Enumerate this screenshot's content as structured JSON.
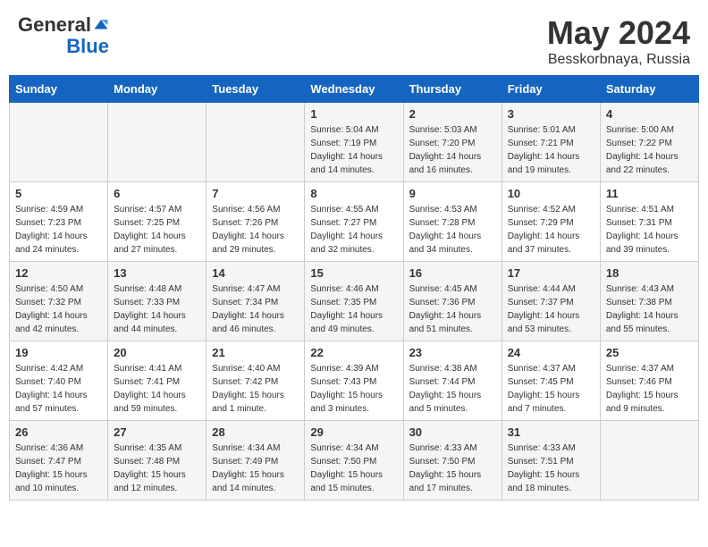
{
  "header": {
    "logo_general": "General",
    "logo_blue": "Blue",
    "title": "May 2024",
    "location": "Besskorbnaya, Russia"
  },
  "weekdays": [
    "Sunday",
    "Monday",
    "Tuesday",
    "Wednesday",
    "Thursday",
    "Friday",
    "Saturday"
  ],
  "weeks": [
    [
      {
        "day": "",
        "info": ""
      },
      {
        "day": "",
        "info": ""
      },
      {
        "day": "",
        "info": ""
      },
      {
        "day": "1",
        "info": "Sunrise: 5:04 AM\nSunset: 7:19 PM\nDaylight: 14 hours\nand 14 minutes."
      },
      {
        "day": "2",
        "info": "Sunrise: 5:03 AM\nSunset: 7:20 PM\nDaylight: 14 hours\nand 16 minutes."
      },
      {
        "day": "3",
        "info": "Sunrise: 5:01 AM\nSunset: 7:21 PM\nDaylight: 14 hours\nand 19 minutes."
      },
      {
        "day": "4",
        "info": "Sunrise: 5:00 AM\nSunset: 7:22 PM\nDaylight: 14 hours\nand 22 minutes."
      }
    ],
    [
      {
        "day": "5",
        "info": "Sunrise: 4:59 AM\nSunset: 7:23 PM\nDaylight: 14 hours\nand 24 minutes."
      },
      {
        "day": "6",
        "info": "Sunrise: 4:57 AM\nSunset: 7:25 PM\nDaylight: 14 hours\nand 27 minutes."
      },
      {
        "day": "7",
        "info": "Sunrise: 4:56 AM\nSunset: 7:26 PM\nDaylight: 14 hours\nand 29 minutes."
      },
      {
        "day": "8",
        "info": "Sunrise: 4:55 AM\nSunset: 7:27 PM\nDaylight: 14 hours\nand 32 minutes."
      },
      {
        "day": "9",
        "info": "Sunrise: 4:53 AM\nSunset: 7:28 PM\nDaylight: 14 hours\nand 34 minutes."
      },
      {
        "day": "10",
        "info": "Sunrise: 4:52 AM\nSunset: 7:29 PM\nDaylight: 14 hours\nand 37 minutes."
      },
      {
        "day": "11",
        "info": "Sunrise: 4:51 AM\nSunset: 7:31 PM\nDaylight: 14 hours\nand 39 minutes."
      }
    ],
    [
      {
        "day": "12",
        "info": "Sunrise: 4:50 AM\nSunset: 7:32 PM\nDaylight: 14 hours\nand 42 minutes."
      },
      {
        "day": "13",
        "info": "Sunrise: 4:48 AM\nSunset: 7:33 PM\nDaylight: 14 hours\nand 44 minutes."
      },
      {
        "day": "14",
        "info": "Sunrise: 4:47 AM\nSunset: 7:34 PM\nDaylight: 14 hours\nand 46 minutes."
      },
      {
        "day": "15",
        "info": "Sunrise: 4:46 AM\nSunset: 7:35 PM\nDaylight: 14 hours\nand 49 minutes."
      },
      {
        "day": "16",
        "info": "Sunrise: 4:45 AM\nSunset: 7:36 PM\nDaylight: 14 hours\nand 51 minutes."
      },
      {
        "day": "17",
        "info": "Sunrise: 4:44 AM\nSunset: 7:37 PM\nDaylight: 14 hours\nand 53 minutes."
      },
      {
        "day": "18",
        "info": "Sunrise: 4:43 AM\nSunset: 7:38 PM\nDaylight: 14 hours\nand 55 minutes."
      }
    ],
    [
      {
        "day": "19",
        "info": "Sunrise: 4:42 AM\nSunset: 7:40 PM\nDaylight: 14 hours\nand 57 minutes."
      },
      {
        "day": "20",
        "info": "Sunrise: 4:41 AM\nSunset: 7:41 PM\nDaylight: 14 hours\nand 59 minutes."
      },
      {
        "day": "21",
        "info": "Sunrise: 4:40 AM\nSunset: 7:42 PM\nDaylight: 15 hours\nand 1 minute."
      },
      {
        "day": "22",
        "info": "Sunrise: 4:39 AM\nSunset: 7:43 PM\nDaylight: 15 hours\nand 3 minutes."
      },
      {
        "day": "23",
        "info": "Sunrise: 4:38 AM\nSunset: 7:44 PM\nDaylight: 15 hours\nand 5 minutes."
      },
      {
        "day": "24",
        "info": "Sunrise: 4:37 AM\nSunset: 7:45 PM\nDaylight: 15 hours\nand 7 minutes."
      },
      {
        "day": "25",
        "info": "Sunrise: 4:37 AM\nSunset: 7:46 PM\nDaylight: 15 hours\nand 9 minutes."
      }
    ],
    [
      {
        "day": "26",
        "info": "Sunrise: 4:36 AM\nSunset: 7:47 PM\nDaylight: 15 hours\nand 10 minutes."
      },
      {
        "day": "27",
        "info": "Sunrise: 4:35 AM\nSunset: 7:48 PM\nDaylight: 15 hours\nand 12 minutes."
      },
      {
        "day": "28",
        "info": "Sunrise: 4:34 AM\nSunset: 7:49 PM\nDaylight: 15 hours\nand 14 minutes."
      },
      {
        "day": "29",
        "info": "Sunrise: 4:34 AM\nSunset: 7:50 PM\nDaylight: 15 hours\nand 15 minutes."
      },
      {
        "day": "30",
        "info": "Sunrise: 4:33 AM\nSunset: 7:50 PM\nDaylight: 15 hours\nand 17 minutes."
      },
      {
        "day": "31",
        "info": "Sunrise: 4:33 AM\nSunset: 7:51 PM\nDaylight: 15 hours\nand 18 minutes."
      },
      {
        "day": "",
        "info": ""
      }
    ]
  ]
}
